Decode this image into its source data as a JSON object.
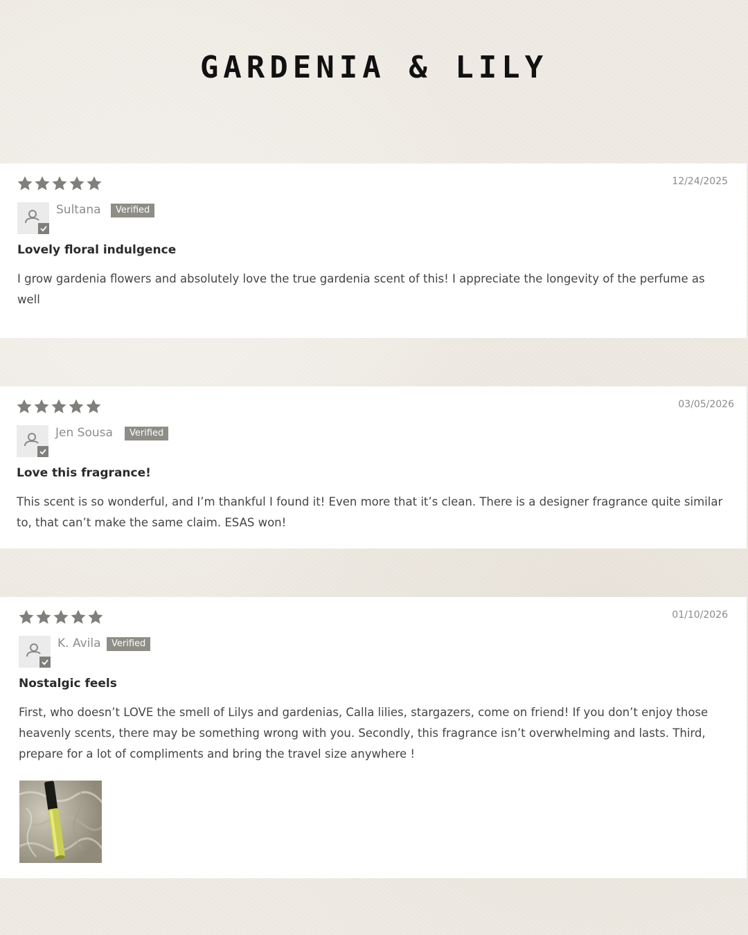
{
  "page": {
    "title": "GARDENIA & LILY"
  },
  "colors": {
    "star": "#7f7f7b",
    "badge": "#8e8d86",
    "background": "#efebe4"
  },
  "reviews": [
    {
      "rating": 5,
      "date": "12/24/2025",
      "author": "Sultana",
      "badge": "Verified",
      "title": "Lovely floral indulgence",
      "body": "I grow gardenia flowers and absolutely love the true gardenia scent of this! I appreciate the longevity of the perfume as well"
    },
    {
      "rating": 5,
      "date": "03/05/2026",
      "author": "Jen Sousa",
      "badge": "Verified",
      "title": "Love this fragrance!",
      "body": "This scent is so wonderful, and I’m thankful I found it! Even more that it’s clean. There is a designer fragrance quite similar to, that can’t make the same claim. ESAS won!"
    },
    {
      "rating": 5,
      "date": "01/10/2026",
      "author": "K. Avila",
      "badge": "Verified",
      "title": "Nostalgic feels",
      "body": "First, who doesn’t LOVE the smell of Lilys and gardenias, Calla lilies, stargazers, come on friend! If you don’t enjoy those heavenly scents, there may be something wrong with you. Secondly, this fragrance isn’t overwhelming and lasts. Third, prepare for a lot of compliments and bring the travel size anywhere !",
      "photo": "perfume-rollerball-photo"
    }
  ]
}
